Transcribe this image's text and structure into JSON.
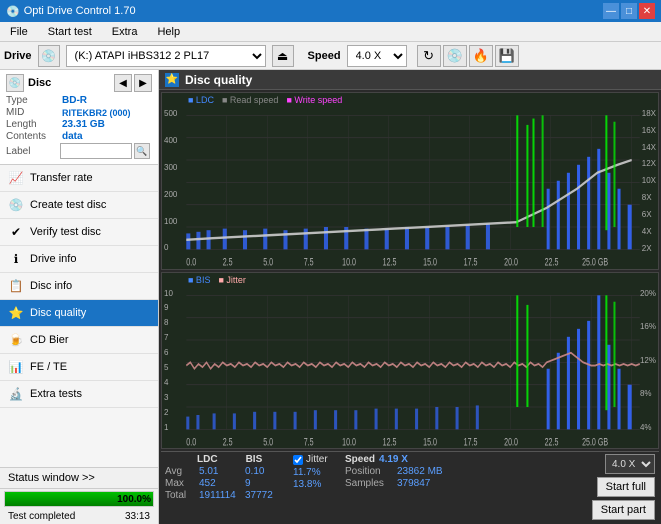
{
  "titlebar": {
    "title": "Opti Drive Control 1.70",
    "icon": "💿",
    "controls": [
      "—",
      "□",
      "✕"
    ]
  },
  "menubar": {
    "items": [
      "File",
      "Start test",
      "Extra",
      "Help"
    ]
  },
  "drivebar": {
    "label": "Drive",
    "drive_value": "(K:)  ATAPI iHBS312  2 PL17",
    "speed_label": "Speed",
    "speed_value": "4.0 X"
  },
  "disc": {
    "title": "Disc",
    "type_label": "Type",
    "type_value": "BD-R",
    "mid_label": "MID",
    "mid_value": "RITEKBR2 (000)",
    "length_label": "Length",
    "length_value": "23.31 GB",
    "contents_label": "Contents",
    "contents_value": "data",
    "label_label": "Label"
  },
  "sidebar": {
    "nav_items": [
      {
        "id": "transfer-rate",
        "label": "Transfer rate",
        "icon": "📈",
        "active": false
      },
      {
        "id": "create-test-disc",
        "label": "Create test disc",
        "icon": "💿",
        "active": false
      },
      {
        "id": "verify-test-disc",
        "label": "Verify test disc",
        "icon": "✔",
        "active": false
      },
      {
        "id": "drive-info",
        "label": "Drive info",
        "icon": "ℹ",
        "active": false
      },
      {
        "id": "disc-info",
        "label": "Disc info",
        "icon": "📋",
        "active": false
      },
      {
        "id": "disc-quality",
        "label": "Disc quality",
        "icon": "⭐",
        "active": true
      },
      {
        "id": "cd-bier",
        "label": "CD Bier",
        "icon": "🍺",
        "active": false
      },
      {
        "id": "fe-te",
        "label": "FE / TE",
        "icon": "📊",
        "active": false
      },
      {
        "id": "extra-tests",
        "label": "Extra tests",
        "icon": "🔬",
        "active": false
      }
    ]
  },
  "status": {
    "window_label": "Status window >>",
    "progress_pct": 100,
    "progress_text": "100.0%",
    "status_text": "Test completed",
    "time_text": "33:13"
  },
  "disc_quality": {
    "title": "Disc quality",
    "chart1": {
      "legend": [
        {
          "label": "LDC",
          "color": "#4444ff"
        },
        {
          "label": "Read speed",
          "color": "#888888"
        },
        {
          "label": "Write speed",
          "color": "#ff44ff"
        }
      ],
      "y_labels_right": [
        "18X",
        "16X",
        "14X",
        "12X",
        "10X",
        "8X",
        "6X",
        "4X",
        "2X"
      ],
      "x_labels": [
        "0.0",
        "2.5",
        "5.0",
        "7.5",
        "10.0",
        "12.5",
        "15.0",
        "17.5",
        "20.0",
        "22.5",
        "25.0 GB"
      ],
      "y_labels_left": [
        "500",
        "400",
        "300",
        "200",
        "100",
        "0"
      ]
    },
    "chart2": {
      "legend": [
        {
          "label": "BIS",
          "color": "#4444ff"
        },
        {
          "label": "Jitter",
          "color": "#ffaaaa"
        }
      ],
      "y_labels_right": [
        "20%",
        "16%",
        "12%",
        "8%",
        "4%"
      ],
      "x_labels": [
        "0.0",
        "2.5",
        "5.0",
        "7.5",
        "10.0",
        "12.5",
        "15.0",
        "17.5",
        "20.0",
        "22.5",
        "25.0 GB"
      ],
      "y_labels_left": [
        "10",
        "9",
        "8",
        "7",
        "6",
        "5",
        "4",
        "3",
        "2",
        "1"
      ]
    }
  },
  "stats": {
    "headers": [
      "LDC",
      "BIS",
      "",
      "Jitter",
      "Speed"
    ],
    "avg_label": "Avg",
    "avg_ldc": "5.01",
    "avg_bis": "0.10",
    "avg_jitter": "11.7%",
    "avg_speed": "4.19 X",
    "max_label": "Max",
    "max_ldc": "452",
    "max_bis": "9",
    "max_jitter": "13.8%",
    "max_speed_label": "Position",
    "max_speed_val": "23862 MB",
    "total_label": "Total",
    "total_ldc": "1911114",
    "total_bis": "37772",
    "total_samples_label": "Samples",
    "total_samples_val": "379847",
    "jitter_checked": true,
    "speed_selector": "4.0 X",
    "btn_start_full": "Start full",
    "btn_start_part": "Start part"
  }
}
